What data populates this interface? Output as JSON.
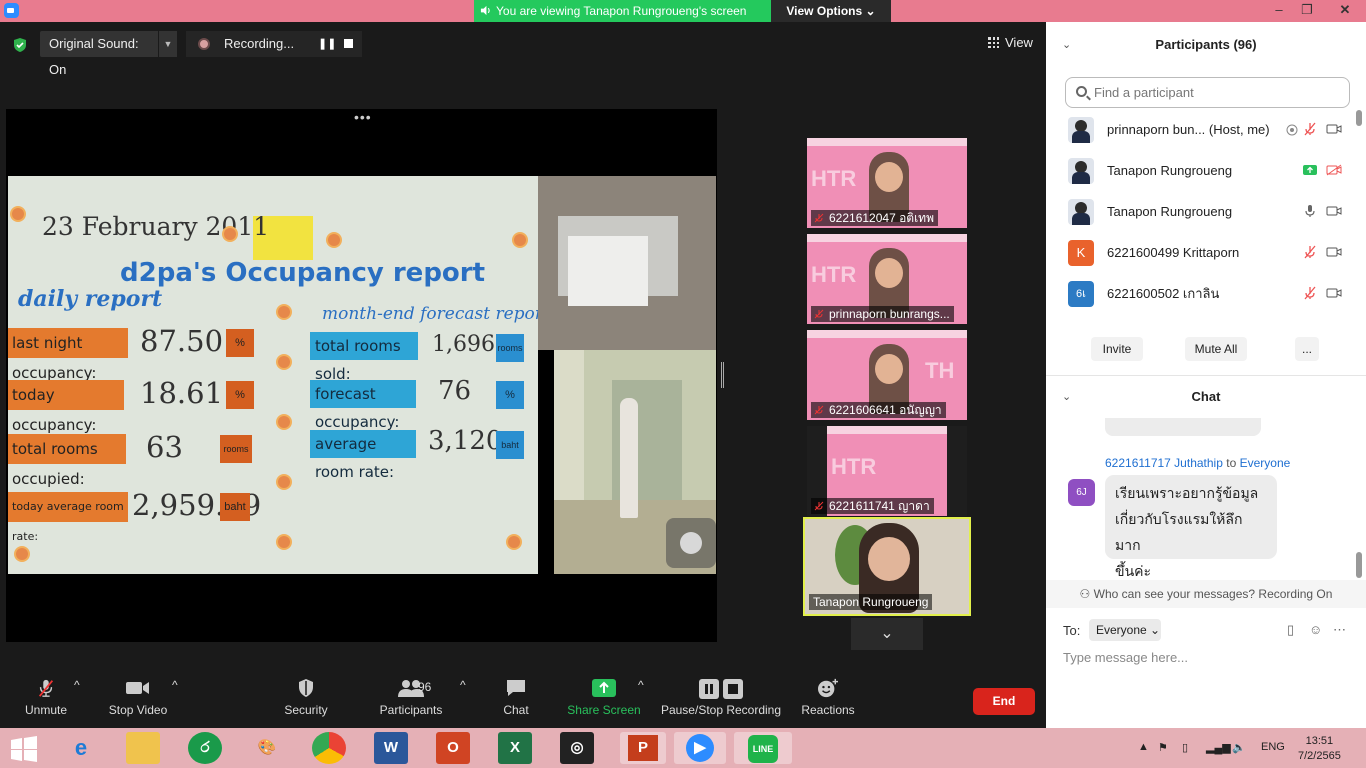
{
  "titlebar": {
    "viewing_banner": "You are viewing Tanapon Rungroueng's screen",
    "view_options": "View Options"
  },
  "top_controls": {
    "original_sound": "Original Sound: On",
    "recording": "Recording...",
    "view": "View"
  },
  "shared_content": {
    "date": "23 February 2011",
    "title": "d2pa's  Occupancy  report",
    "daily_report": "daily report",
    "forecast_report": "month-end forecast report",
    "left_rows": [
      {
        "label": "last night occupancy:",
        "value": "87.50",
        "unit": "%"
      },
      {
        "label": "today occupancy:",
        "value": "18.61",
        "unit": "%"
      },
      {
        "label": "total rooms occupied:",
        "value": "63",
        "unit": "rooms"
      },
      {
        "label": "today average room rate:",
        "value": "2,959.69",
        "unit": "baht"
      }
    ],
    "right_rows": [
      {
        "label": "total rooms sold:",
        "value": "1,696",
        "unit": "rooms"
      },
      {
        "label": "forecast occupancy:",
        "value": "76",
        "unit": "%"
      },
      {
        "label": "average room rate:",
        "value": "3,120",
        "unit": "baht"
      }
    ]
  },
  "video_tiles": [
    {
      "name": "6221612047 อติเทพ",
      "banner": "HTR"
    },
    {
      "name": "prinnaporn bunrangs...",
      "banner": "HTR"
    },
    {
      "name": "6221606641 อนัญญา",
      "banner": "TH"
    },
    {
      "name": "6221611741 ญาดา",
      "banner": "HTR"
    }
  ],
  "active_speaker": "Tanapon Rungroueng",
  "toolbar": {
    "unmute": "Unmute",
    "stop_video": "Stop Video",
    "security": "Security",
    "participants": "Participants",
    "participants_count": "96",
    "chat": "Chat",
    "share_screen": "Share Screen",
    "pause_stop_recording": "Pause/Stop Recording",
    "reactions": "Reactions",
    "end": "End"
  },
  "participants_panel": {
    "title": "Participants (96)",
    "search_placeholder": "Find a participant",
    "rows": [
      {
        "name": "prinnaporn bun...  (Host, me)",
        "avatar": ""
      },
      {
        "name": "Tanapon Rungroueng",
        "avatar": ""
      },
      {
        "name": "Tanapon Rungroueng",
        "avatar": ""
      },
      {
        "name": "6221600499 Krittaporn",
        "avatar": "K"
      },
      {
        "name": "6221600502 เกาลิน",
        "avatar": "6เ"
      }
    ],
    "invite": "Invite",
    "mute_all": "Mute All",
    "more": "..."
  },
  "chat_panel": {
    "title": "Chat",
    "sender": "6221611717 Juthathip",
    "to_word": "to",
    "recipient": "Everyone",
    "sender_avatar": "6J",
    "message_lines": [
      "เรียนเพราะอยากรู้ข้อมูล",
      "เกี่ยวกับโรงแรมให้ลึกมาก",
      "ขึ้นค่ะ"
    ],
    "who_can_see": "Who can see your messages? Recording On",
    "to_label": "To:",
    "to_value": "Everyone",
    "input_placeholder": "Type message here..."
  },
  "taskbar": {
    "language": "ENG",
    "time": "13:51",
    "date": "7/2/2565"
  },
  "colors": {
    "accent_green": "#24c95d",
    "end_red": "#d9241c",
    "zoom_blue": "#2d8cff",
    "speaker_border": "#e2f04b"
  }
}
